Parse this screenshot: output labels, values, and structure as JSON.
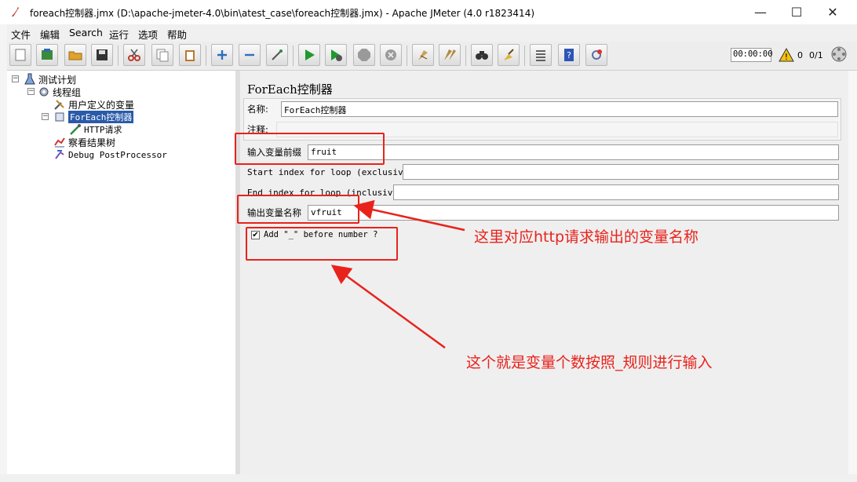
{
  "window": {
    "title": "foreach控制器.jmx (D:\\apache-jmeter-4.0\\bin\\atest_case\\foreach控制器.jmx) - Apache JMeter (4.0 r1823414)",
    "minimize": "—",
    "maximize": "☐",
    "close": "✕"
  },
  "menu": [
    "文件",
    "编辑",
    "Search",
    "运行",
    "选项",
    "帮助"
  ],
  "toolbar": {
    "timer": "00:00:00",
    "warn_count": "0",
    "threads": "0/1"
  },
  "tree": {
    "items": [
      {
        "label": "测试计划"
      },
      {
        "label": "线程组"
      },
      {
        "label": "用户定义的变量"
      },
      {
        "label": "ForEach控制器"
      },
      {
        "label": "HTTP请求"
      },
      {
        "label": "察看结果树"
      },
      {
        "label": "Debug PostProcessor"
      }
    ]
  },
  "form": {
    "title": "ForEach控制器",
    "name_label": "名称:",
    "name_value": "ForEach控制器",
    "comment_label": "注释:",
    "input_prefix_label": "输入变量前缀",
    "input_prefix_value": "fruit",
    "start_index_label": "Start index for loop (exclusive)",
    "start_index_value": "",
    "end_index_label": "End index for loop (inclusive)",
    "end_index_value": "",
    "output_var_label": "输出变量名称",
    "output_var_value": "vfruit",
    "add_underscore_label": "Add \"_\" before number ?",
    "add_underscore_checked": true
  },
  "annotations": {
    "note1": "这里对应http请求输出的变量名称",
    "note2": "这个就是变量个数按照_规则进行输入"
  },
  "colors": {
    "annotation": "#e8231c",
    "selection": "#2a5aa8"
  }
}
